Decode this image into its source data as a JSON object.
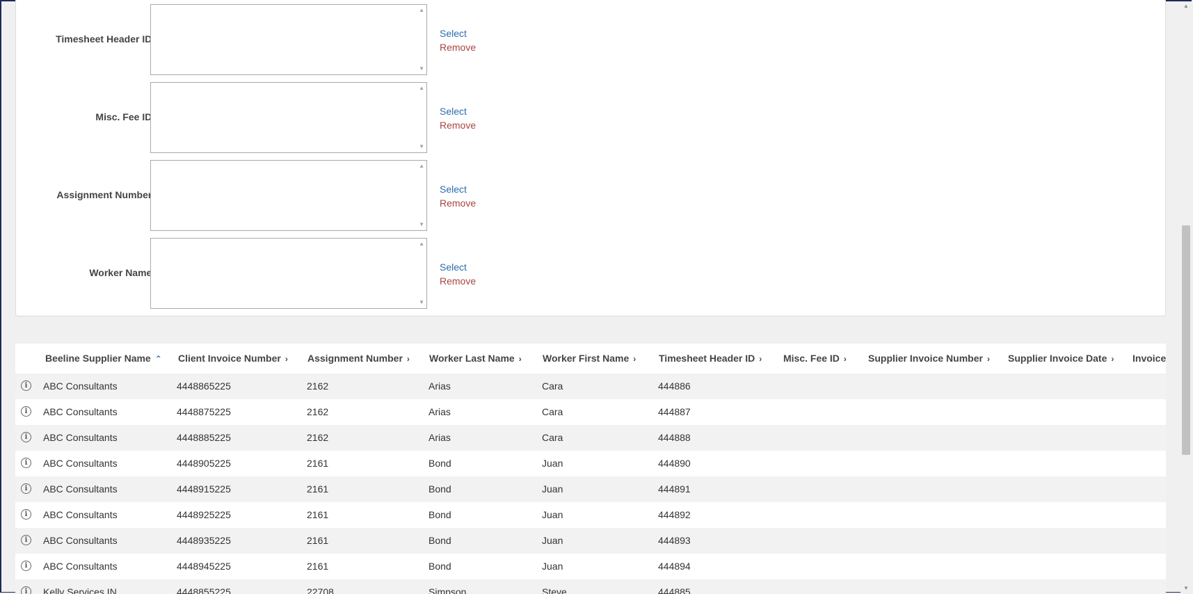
{
  "filters": [
    {
      "label": "Timesheet Header ID:",
      "select": "Select",
      "remove": "Remove"
    },
    {
      "label": "Misc. Fee ID:",
      "select": "Select",
      "remove": "Remove"
    },
    {
      "label": "Assignment Number:",
      "select": "Select",
      "remove": "Remove"
    },
    {
      "label": "Worker Name:",
      "select": "Select",
      "remove": "Remove"
    }
  ],
  "grid": {
    "sorted_column": "Beeline Supplier Name",
    "sort_direction": "ascending",
    "columns": [
      "Beeline Supplier Name",
      "Client Invoice Number",
      "Assignment Number",
      "Worker Last Name",
      "Worker First Name",
      "Timesheet Header ID",
      "Misc. Fee ID",
      "Supplier Invoice Number",
      "Supplier Invoice Date",
      "Invoice"
    ],
    "rows": [
      [
        "ABC Consultants",
        "4448865225",
        "2162",
        "Arias",
        "Cara",
        "444886"
      ],
      [
        "ABC Consultants",
        "4448875225",
        "2162",
        "Arias",
        "Cara",
        "444887"
      ],
      [
        "ABC Consultants",
        "4448885225",
        "2162",
        "Arias",
        "Cara",
        "444888"
      ],
      [
        "ABC Consultants",
        "4448905225",
        "2161",
        "Bond",
        "Juan",
        "444890"
      ],
      [
        "ABC Consultants",
        "4448915225",
        "2161",
        "Bond",
        "Juan",
        "444891"
      ],
      [
        "ABC Consultants",
        "4448925225",
        "2161",
        "Bond",
        "Juan",
        "444892"
      ],
      [
        "ABC Consultants",
        "4448935225",
        "2161",
        "Bond",
        "Juan",
        "444893"
      ],
      [
        "ABC Consultants",
        "4448945225",
        "2161",
        "Bond",
        "Juan",
        "444894"
      ],
      [
        "Kelly Services IN",
        "4448855225",
        "22708",
        "Simpson",
        "Steve",
        "444885"
      ]
    ]
  },
  "colors": {
    "select_link": "#2a6db0",
    "remove_link": "#a94442",
    "row_alt": "#f2f2f2",
    "frame": "#1b2a5c"
  }
}
